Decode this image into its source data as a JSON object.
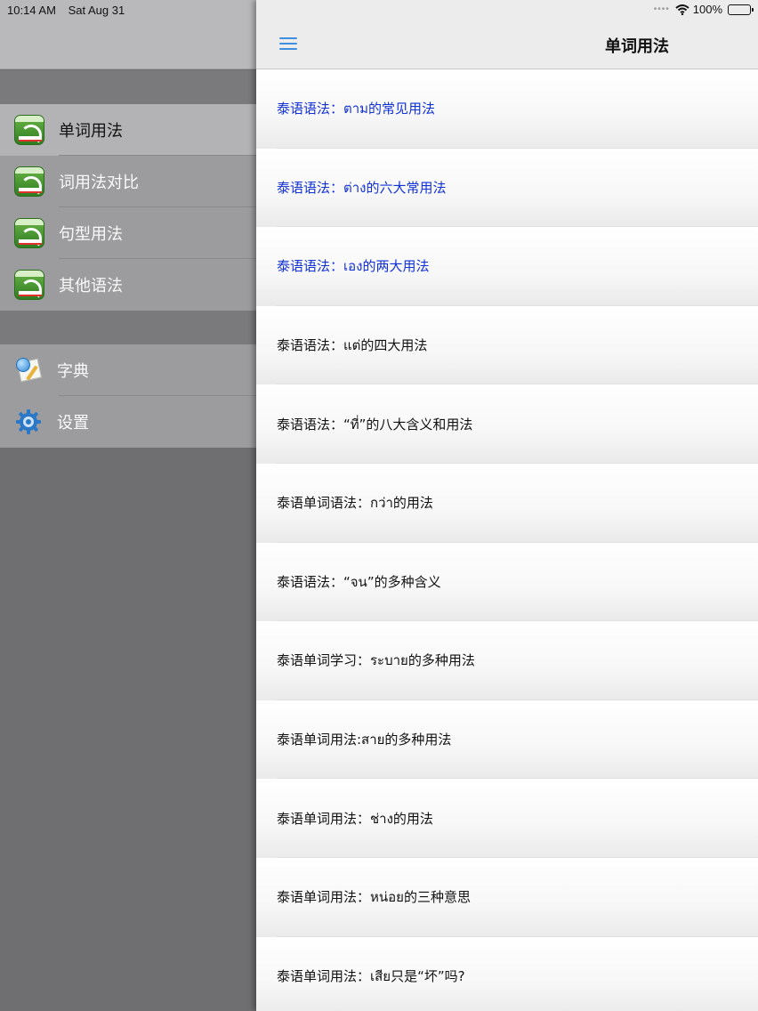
{
  "status_bar": {
    "time": "10:14 AM",
    "date": "Sat Aug 31",
    "battery": "100%",
    "battery_level": 1.0,
    "wifi_icon": "wifi-icon"
  },
  "sidebar": {
    "main_items": [
      {
        "label": "单词用法",
        "icon": "app-book-icon",
        "selected": true
      },
      {
        "label": "词用法对比",
        "icon": "app-book-icon",
        "selected": false
      },
      {
        "label": "句型用法",
        "icon": "app-book-icon",
        "selected": false
      },
      {
        "label": "其他语法",
        "icon": "app-book-icon",
        "selected": false
      }
    ],
    "extra_items": [
      {
        "label": "字典",
        "icon": "dictionary-icon"
      },
      {
        "label": "设置",
        "icon": "gear-icon"
      }
    ]
  },
  "navbar": {
    "title": "单词用法",
    "menu_icon": "menu-icon"
  },
  "list": {
    "items": [
      {
        "text": "泰语语法：ตาม的常见用法",
        "visited": true
      },
      {
        "text": "泰语语法：ต่าง的六大常用法",
        "visited": true
      },
      {
        "text": "泰语语法：เอง的两大用法",
        "visited": true
      },
      {
        "text": "泰语语法：แต่的四大用法",
        "visited": false
      },
      {
        "text": "泰语语法：“ที่”的八大含义和用法",
        "visited": false
      },
      {
        "text": "泰语单词语法：กว่า的用法",
        "visited": false
      },
      {
        "text": "泰语语法：“จน”的多种含义",
        "visited": false
      },
      {
        "text": "泰语单词学习：ระบาย的多种用法",
        "visited": false
      },
      {
        "text": "泰语单词用法:สาย的多种用法",
        "visited": false
      },
      {
        "text": "泰语单词用法：ช่าง的用法",
        "visited": false
      },
      {
        "text": "泰语单词用法：หน่อย的三种意思",
        "visited": false
      },
      {
        "text": "泰语单词用法：เสีย只是“坏”吗?",
        "visited": false
      }
    ]
  },
  "colors": {
    "visited_link": "#1030d8",
    "accent": "#3f8fe0"
  }
}
